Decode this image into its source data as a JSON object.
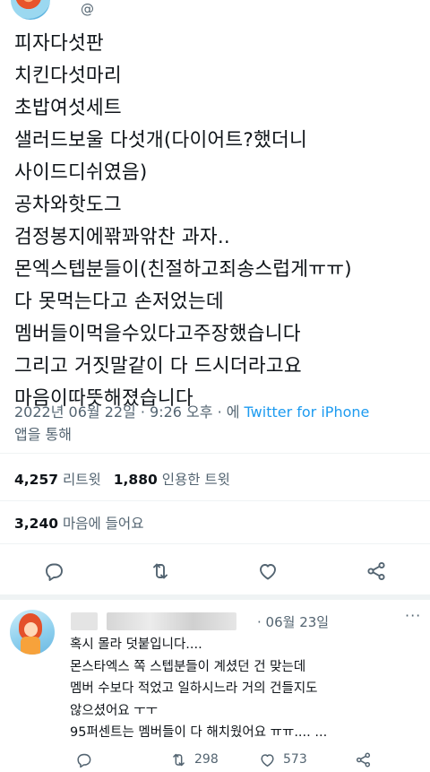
{
  "header": {
    "handle_fragment": "@"
  },
  "tweet": {
    "lines": [
      "피자다섯판",
      "치킨다섯마리",
      "초밥여섯세트",
      "샐러드보울 다섯개(다이어트?했더니",
      "사이드디쉬였음)",
      "공차와핫도그",
      "검정봉지에꽊꽈앆찬 과자..",
      "몬엑스텝분들이(친절하고죄송스럽게ㅠㅠ)",
      "다 못먹는다고 손저었는데",
      "멤버들이먹을수있다고주장했습니다",
      "그리고 거짓말같이 다 드시더라고요",
      "마음이따뜻해졌습니다"
    ],
    "meta_date": "2022년 06월 22일 · 9:26 오후 · 에 ",
    "meta_source": "Twitter for iPhone",
    "meta_suffix": "앱을 통해"
  },
  "stats": {
    "retweets_count": "4,257",
    "retweets_label": "리트윗",
    "quotes_count": "1,880",
    "quotes_label": "인용한 트윗",
    "likes_count": "3,240",
    "likes_label": "마음에 들어요"
  },
  "icons": {
    "reply": "reply-icon",
    "retweet": "retweet-icon",
    "like": "heart-icon",
    "share": "share-icon",
    "more": "more-icon"
  },
  "reply": {
    "date": "· 06월 23일",
    "more": "···",
    "lines": [
      "혹시 몰라 덧붙입니다....",
      "몬스타엑스 쪽 스텝분들이 계셨던 건 맞는데",
      "멤버 수보다 적었고 일하시느라 거의 건들지도",
      "않으셨어요 ㅜㅜ",
      "95퍼센트는 멤버들이 다 해치웠어요 ㅠㅠ.... ..."
    ],
    "retweets": "298",
    "likes": "573"
  },
  "colors": {
    "text": "#0f1419",
    "secondary": "#536471",
    "link": "#1d9bf0",
    "divider": "#eff3f4"
  }
}
